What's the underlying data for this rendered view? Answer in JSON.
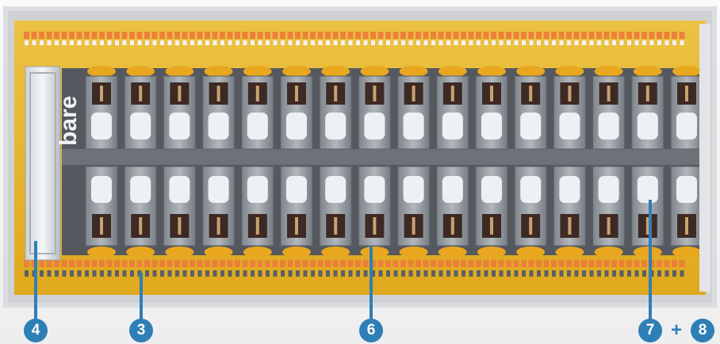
{
  "image": {
    "brand_text": "bare",
    "colors": {
      "board": "#e7b320",
      "terminal_orange": "#ec7f3c",
      "relay_gray": "#8c9298",
      "relay_dark": "#3d2a24",
      "accent_blue": "#2e7fb6"
    },
    "relay_count_per_row": 16,
    "relay_rows": 2
  },
  "callouts": [
    {
      "number": "4"
    },
    {
      "number": "3"
    },
    {
      "number": "6"
    },
    {
      "number": "7"
    }
  ],
  "plus_text": "+",
  "extra_callout": "8"
}
